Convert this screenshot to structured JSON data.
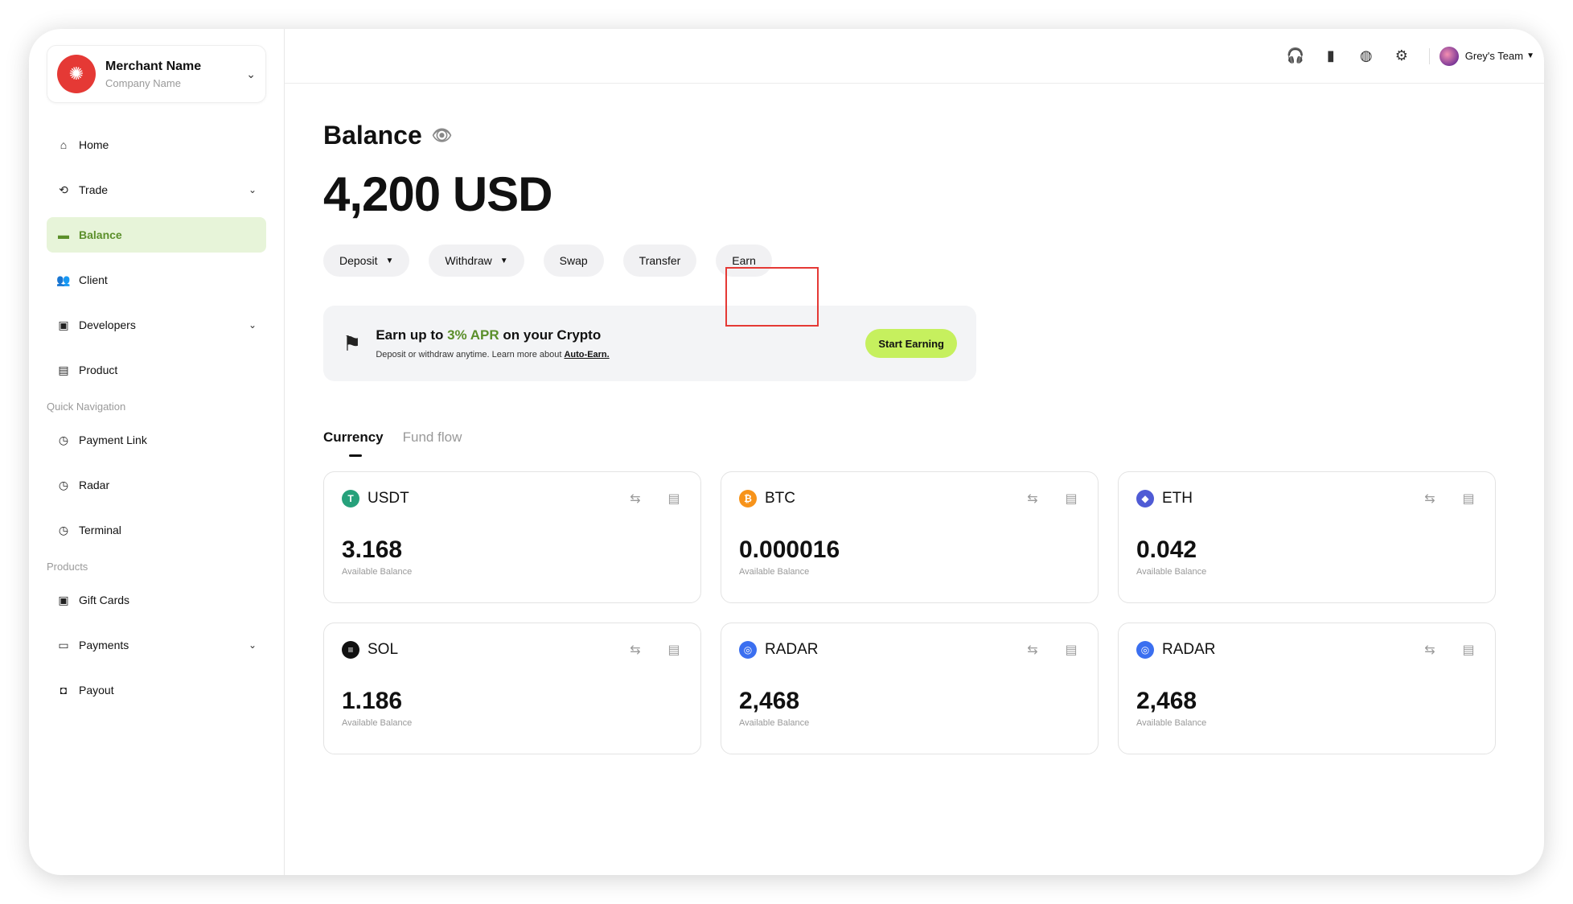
{
  "merchant": {
    "name": "Merchant Name",
    "company": "Company Name"
  },
  "sidebar": {
    "items": [
      {
        "label": "Home"
      },
      {
        "label": "Trade"
      },
      {
        "label": "Balance"
      },
      {
        "label": "Client"
      },
      {
        "label": "Developers"
      },
      {
        "label": "Product"
      }
    ],
    "quick_nav_label": "Quick Navigation",
    "quick_nav": [
      {
        "label": "Payment Link"
      },
      {
        "label": "Radar"
      },
      {
        "label": "Terminal"
      }
    ],
    "products_label": "Products",
    "products": [
      {
        "label": "Gift Cards"
      },
      {
        "label": "Payments"
      },
      {
        "label": "Payout"
      }
    ]
  },
  "topbar": {
    "team": "Grey's Team"
  },
  "balance": {
    "title": "Balance",
    "amount": "4,200 USD",
    "actions": {
      "deposit": "Deposit",
      "withdraw": "Withdraw",
      "swap": "Swap",
      "transfer": "Transfer",
      "earn": "Earn"
    }
  },
  "promo": {
    "title_pre": "Earn up to ",
    "apr": "3% APR",
    "title_post": " on your Crypto",
    "subtitle": "Deposit or withdraw anytime. Learn more about ",
    "link": "Auto-Earn.",
    "button": "Start Earning"
  },
  "tabs": {
    "currency": "Currency",
    "fund_flow": "Fund flow"
  },
  "cards": [
    {
      "name": "USDT",
      "value": "3.168",
      "sub": "Available Balance",
      "color": "#26a17b",
      "symbol": "T"
    },
    {
      "name": "BTC",
      "value": "0.000016",
      "sub": "Available Balance",
      "color": "#f7931a",
      "symbol": "₿"
    },
    {
      "name": "ETH",
      "value": "0.042",
      "sub": "Available Balance",
      "color": "#4f5bd5",
      "symbol": "◆"
    },
    {
      "name": "SOL",
      "value": "1.186",
      "sub": "Available Balance",
      "color": "#111111",
      "symbol": "≡"
    },
    {
      "name": "RADAR",
      "value": "2,468",
      "sub": "Available Balance",
      "color": "#3b6ff0",
      "symbol": "◎"
    },
    {
      "name": "RADAR",
      "value": "2,468",
      "sub": "Available Balance",
      "color": "#3b6ff0",
      "symbol": "◎"
    }
  ]
}
